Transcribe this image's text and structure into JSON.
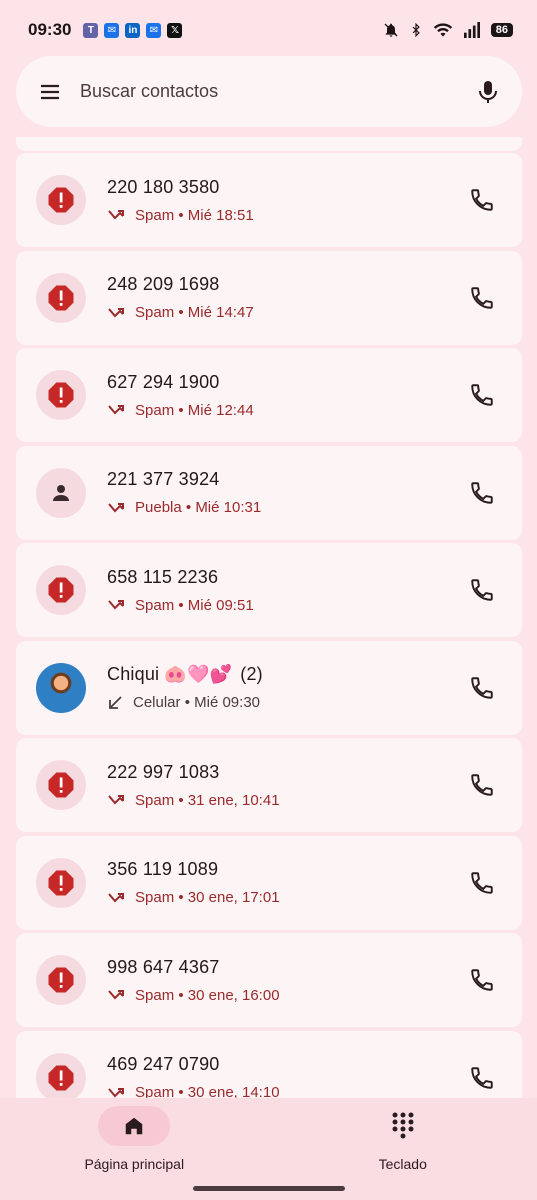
{
  "status_bar": {
    "time": "09:30",
    "battery": "86",
    "notification_icons": [
      "teams-icon",
      "outlook-icon",
      "linkedin-icon",
      "outlook-icon",
      "x-icon"
    ],
    "system_icons": [
      "mute-icon",
      "bluetooth-icon",
      "wifi-icon",
      "signal-icon",
      "battery-icon"
    ]
  },
  "search": {
    "placeholder": "Buscar contactos",
    "menu_icon": "menu-icon",
    "mic_icon": "mic-icon"
  },
  "calls": [
    {
      "caller": "220 180 3580",
      "type": "spam",
      "label": "Spam",
      "time": "Mié 18:51",
      "direction": "missed"
    },
    {
      "caller": "248 209 1698",
      "type": "spam",
      "label": "Spam",
      "time": "Mié 14:47",
      "direction": "missed"
    },
    {
      "caller": "627 294 1900",
      "type": "spam",
      "label": "Spam",
      "time": "Mié 12:44",
      "direction": "missed"
    },
    {
      "caller": "221 377 3924",
      "type": "unknown",
      "label": "Puebla",
      "time": "Mié 10:31",
      "direction": "missed"
    },
    {
      "caller": "658 115 2236",
      "type": "spam",
      "label": "Spam",
      "time": "Mié 09:51",
      "direction": "missed"
    },
    {
      "caller": "Chiqui 🐽🩷💕",
      "count": "(2)",
      "type": "contact",
      "label": "Celular",
      "time": "Mié 09:30",
      "direction": "incoming"
    },
    {
      "caller": "222 997 1083",
      "type": "spam",
      "label": "Spam",
      "time": "31 ene, 10:41",
      "direction": "missed"
    },
    {
      "caller": "356 119 1089",
      "type": "spam",
      "label": "Spam",
      "time": "30 ene, 17:01",
      "direction": "missed"
    },
    {
      "caller": "998 647 4367",
      "type": "spam",
      "label": "Spam",
      "time": "30 ene, 16:00",
      "direction": "missed"
    },
    {
      "caller": "469 247 0790",
      "type": "spam",
      "label": "Spam",
      "time": "30 ene, 14:10",
      "direction": "missed"
    }
  ],
  "nav": {
    "home_label": "Página principal",
    "keypad_label": "Teclado"
  },
  "colors": {
    "background": "#fce4e9",
    "card": "#fdf4f5",
    "spam_red": "#c62828",
    "spam_text": "#9b2a2c",
    "active_pill": "#f7c9d2"
  }
}
